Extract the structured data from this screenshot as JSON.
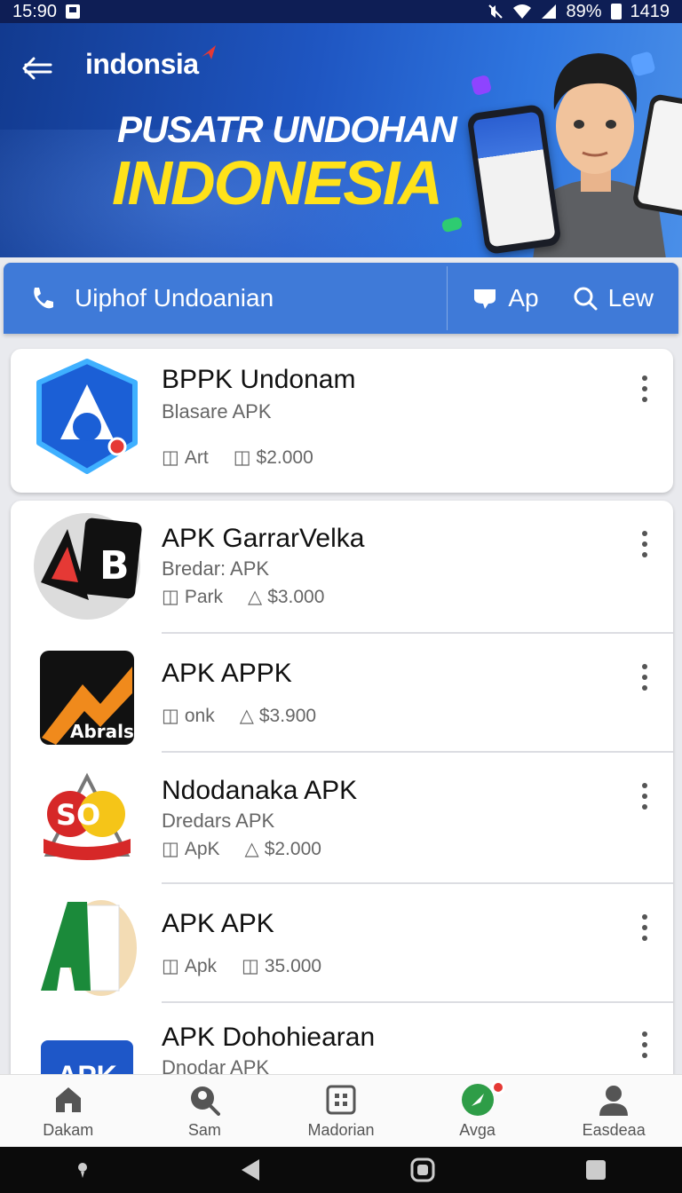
{
  "status_bar": {
    "time": "15:90",
    "battery": "89%",
    "extra": "1419"
  },
  "banner": {
    "brand": "indonsia",
    "headline_line1": "PUSATR UNDOHAN",
    "headline_line2": "INDONESIA"
  },
  "search": {
    "placeholder": "Uiphof Undoanian",
    "action1": "Ap",
    "action2": "Lew"
  },
  "featured": {
    "title": "BPPK Undonam",
    "subtitle": "Blasare   APK",
    "meta1": "Art",
    "meta2": "$2.000"
  },
  "apps": [
    {
      "title": "APK GarrarVelka",
      "subtitle": "Bredar: APK",
      "meta1": "Park",
      "meta2": "$3.000",
      "icon_text": "B"
    },
    {
      "title": "APK APPK",
      "subtitle": "",
      "meta1": "onk",
      "meta2": "$3.900",
      "icon_text": "Abrals"
    },
    {
      "title": "Ndodanaka APK",
      "subtitle": "Dredars  APK",
      "meta1": "ApK",
      "meta2": "$2.000",
      "icon_text": "SO"
    },
    {
      "title": "APK APK",
      "subtitle": "",
      "meta1": "Apk",
      "meta2": "35.000",
      "icon_text": "A"
    },
    {
      "title": "APK Dohohiearan",
      "subtitle": "Dnodar APK",
      "meta1": "",
      "meta2": "",
      "icon_text": "APK"
    }
  ],
  "bottom_nav": [
    {
      "label": "Dakam",
      "icon": "home-icon"
    },
    {
      "label": "Sam",
      "icon": "search-person-icon"
    },
    {
      "label": "Madorian",
      "icon": "grid-icon"
    },
    {
      "label": "Avga",
      "icon": "compass-icon"
    },
    {
      "label": "Easdeaa",
      "icon": "profile-icon"
    }
  ],
  "colors": {
    "brand_blue": "#3f7ad8",
    "headline_yellow": "#ffe21a",
    "banner_dark": "#123a8f"
  }
}
